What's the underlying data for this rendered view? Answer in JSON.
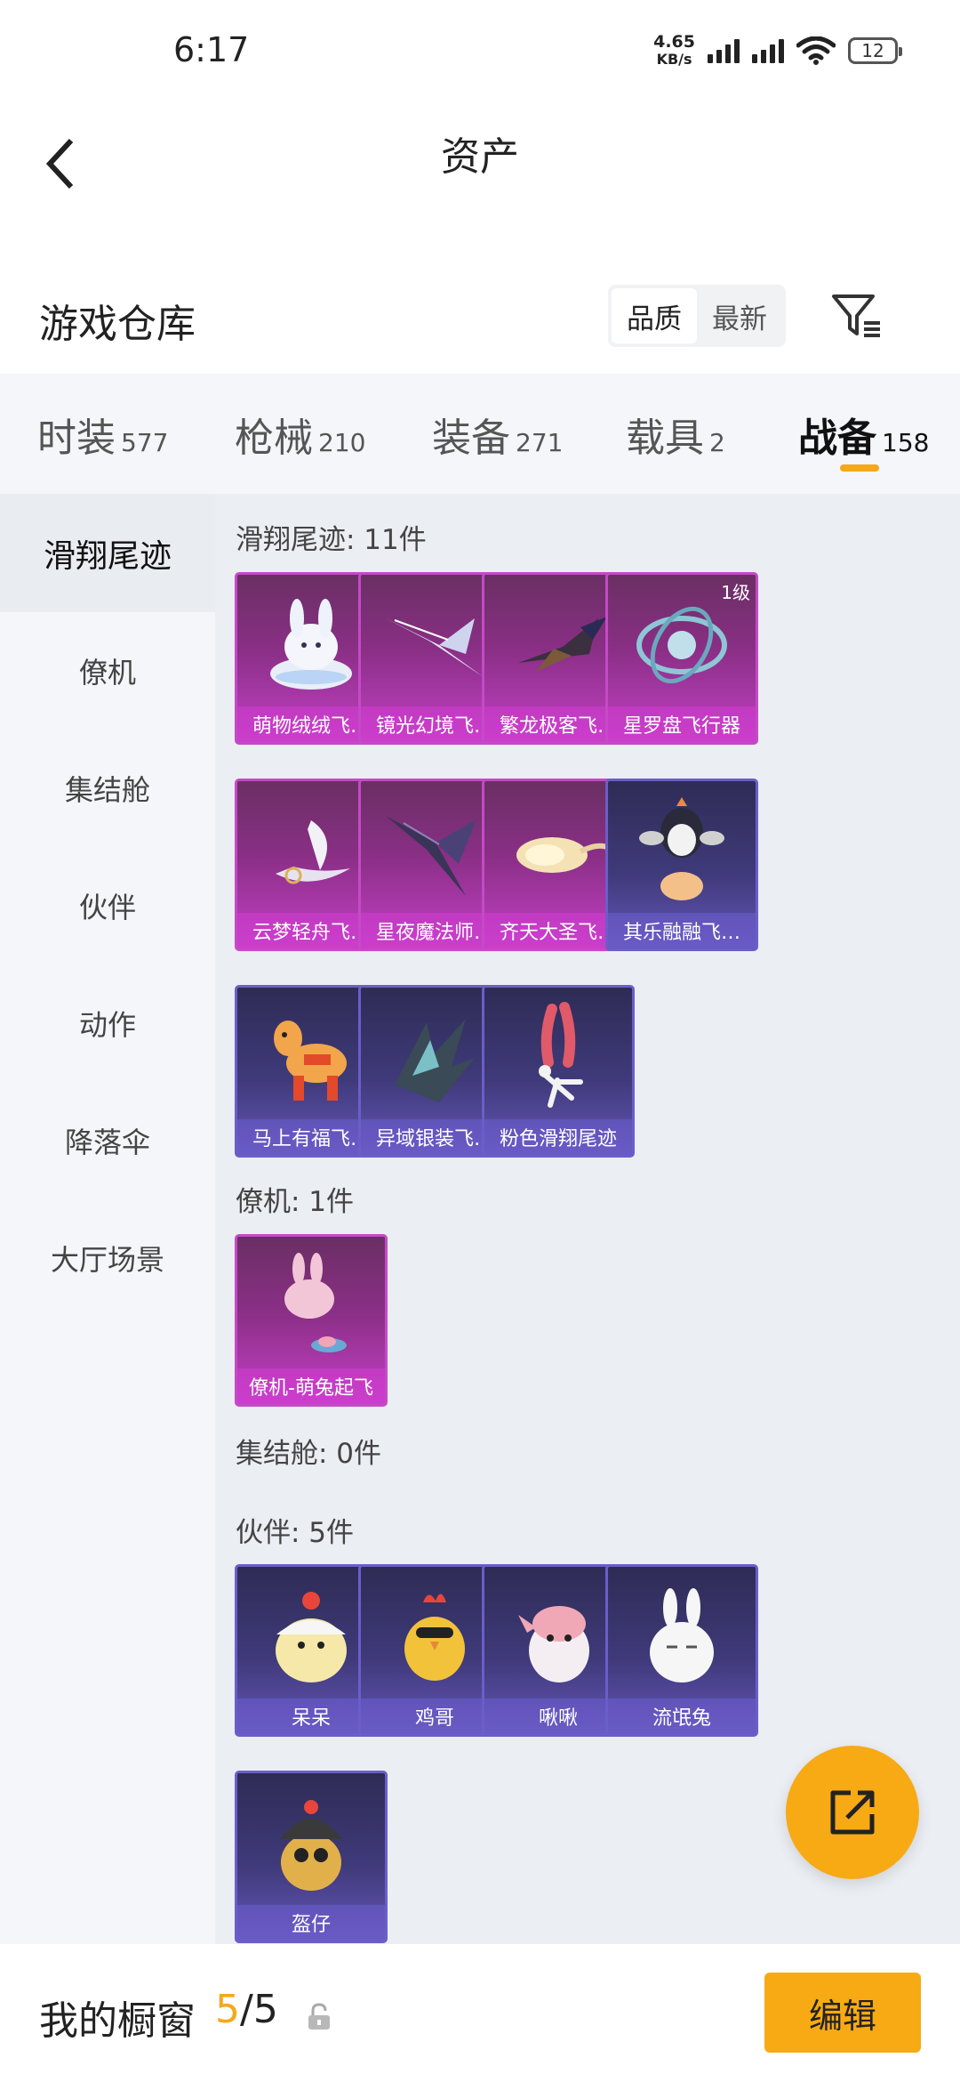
{
  "status_bar": {
    "time": "6:17",
    "net_speed_value": "4.65",
    "net_speed_unit": "KB/s",
    "battery": "12"
  },
  "header": {
    "title": "资产"
  },
  "warehouse": {
    "title": "游戏仓库",
    "sort_options": [
      "品质",
      "最新"
    ],
    "active_sort": "品质"
  },
  "category_tabs": [
    {
      "label": "时装",
      "count": "577"
    },
    {
      "label": "枪械",
      "count": "210"
    },
    {
      "label": "装备",
      "count": "271"
    },
    {
      "label": "载具",
      "count": "2"
    },
    {
      "label": "战备",
      "count": "158",
      "active": true
    }
  ],
  "side_nav": [
    {
      "label": "滑翔尾迹",
      "active": true
    },
    {
      "label": "僚机"
    },
    {
      "label": "集结舱"
    },
    {
      "label": "伙伴"
    },
    {
      "label": "动作"
    },
    {
      "label": "降落伞"
    },
    {
      "label": "大厅场景"
    }
  ],
  "sections": {
    "glide_trails": {
      "title": "滑翔尾迹: 11件",
      "items": [
        {
          "name": "萌物绒绒飞…",
          "tier": "purple",
          "icon": "bunny-shoe-icon"
        },
        {
          "name": "镜光幻境飞…",
          "tier": "purple",
          "icon": "crystal-wings-icon"
        },
        {
          "name": "繁龙极客飞…",
          "tier": "purple",
          "icon": "dragon-glider-icon"
        },
        {
          "name": "星罗盘飞行器",
          "tier": "purple",
          "icon": "star-compass-icon",
          "level": "1级"
        },
        {
          "name": "云梦轻舟飞…",
          "tier": "purple",
          "icon": "cloud-boat-icon"
        },
        {
          "name": "星夜魔法师…",
          "tier": "purple",
          "icon": "dark-wings-icon"
        },
        {
          "name": "齐天大圣飞…",
          "tier": "purple",
          "icon": "golden-cloud-icon"
        },
        {
          "name": "其乐融融飞…",
          "tier": "blue",
          "icon": "penguin-glider-icon"
        },
        {
          "name": "马上有福飞…",
          "tier": "blue",
          "icon": "toy-horse-icon"
        },
        {
          "name": "异域银装飞…",
          "tier": "blue",
          "icon": "silver-wings-icon"
        },
        {
          "name": "粉色滑翔尾迹",
          "tier": "blue",
          "icon": "pink-smoke-icon"
        }
      ]
    },
    "wingman": {
      "title": "僚机: 1件",
      "items": [
        {
          "name": "僚机-萌兔起飞",
          "tier": "purple",
          "icon": "bunny-drone-icon"
        }
      ]
    },
    "rally_pod": {
      "title": "集结舱: 0件"
    },
    "companions": {
      "title": "伙伴: 5件",
      "items": [
        {
          "name": "呆呆",
          "tier": "blue",
          "icon": "chick-icon"
        },
        {
          "name": "鸡哥",
          "tier": "blue",
          "icon": "rooster-icon"
        },
        {
          "name": "啾啾",
          "tier": "blue",
          "icon": "pink-bird-icon"
        },
        {
          "name": "流氓兔",
          "tier": "blue",
          "icon": "white-rabbit-icon"
        },
        {
          "name": "盔仔",
          "tier": "blue",
          "icon": "helmet-chick-icon"
        }
      ]
    }
  },
  "showcase": {
    "title": "我的橱窗",
    "current": "5",
    "separator_total": "/5",
    "edit_label": "编辑"
  },
  "colors": {
    "accent": "#f7aa14",
    "purple_tier": "#c44ac6",
    "blue_tier": "#6a5ec9"
  }
}
